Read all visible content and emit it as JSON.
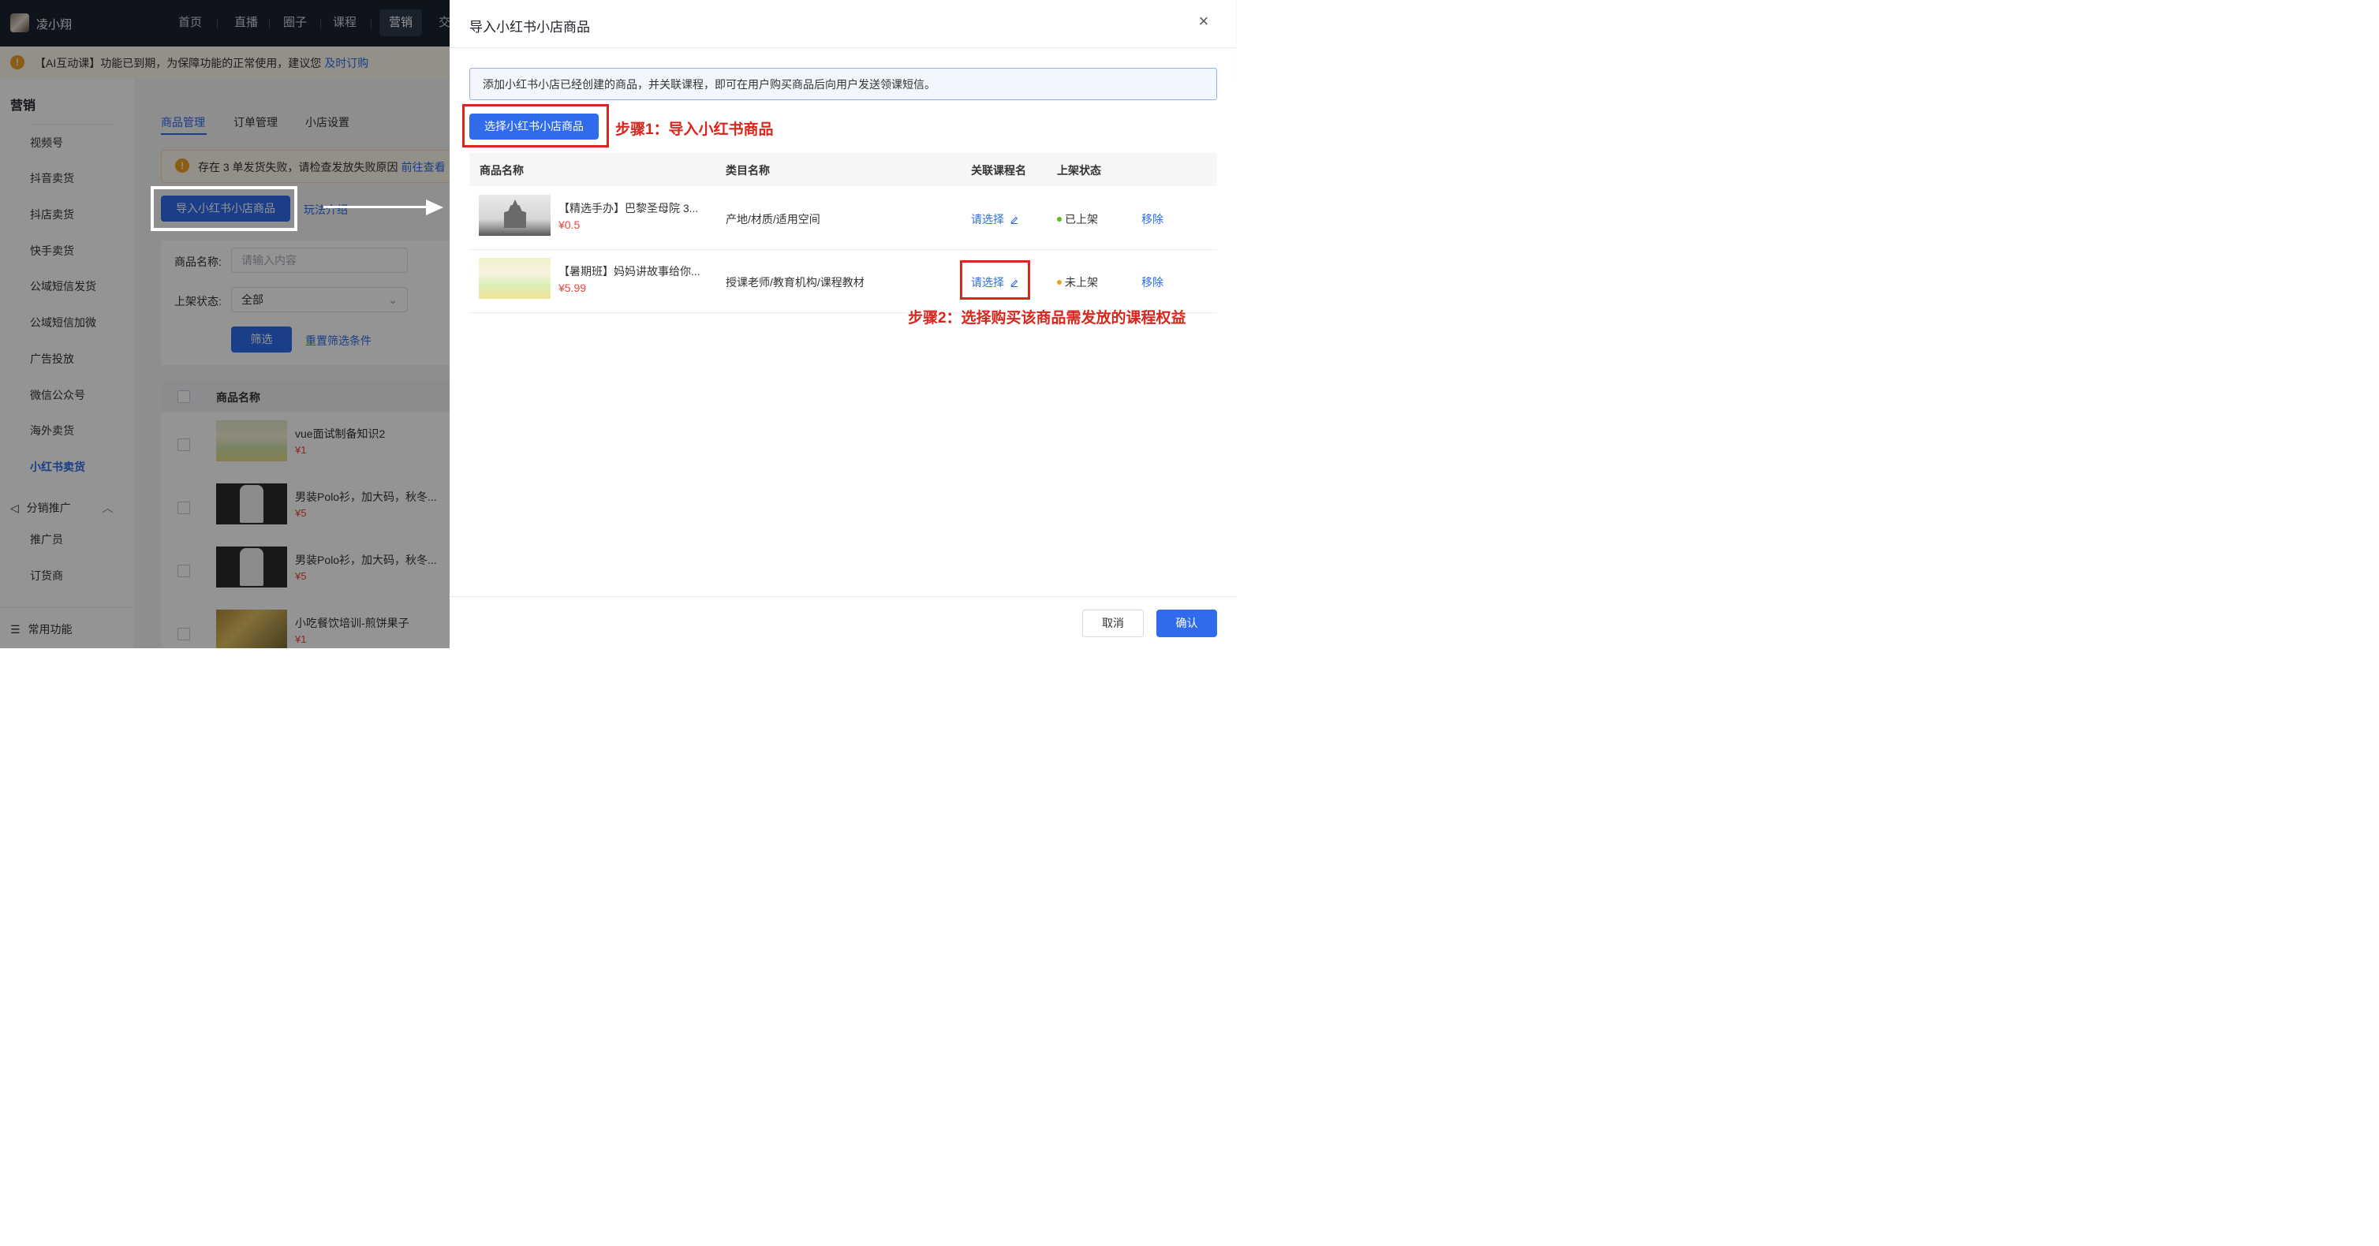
{
  "app": {
    "name": "凌小翔",
    "nav": [
      "首页",
      "直播",
      "圈子",
      "课程",
      "营销",
      "交"
    ],
    "warning": {
      "text": "【AI互动课】功能已到期，为保障功能的正常使用，建议您",
      "link": "及时订购"
    }
  },
  "sidebar": {
    "title": "营销",
    "items": [
      "视频号",
      "抖音卖货",
      "抖店卖货",
      "快手卖货",
      "公域短信发货",
      "公域短信加微",
      "广告投放",
      "微信公众号",
      "海外卖货",
      "小红书卖货"
    ],
    "group": "分销推广",
    "group_items": [
      "推广员",
      "订货商"
    ],
    "bottom": "常用功能"
  },
  "main": {
    "tabs": [
      "商品管理",
      "订单管理",
      "小店设置"
    ],
    "alert": {
      "text": "存在 3 单发货失败，请检查发放失败原因",
      "link": "前往查看"
    },
    "import_button": "导入小红书小店商品",
    "play_link": "玩法介绍",
    "filter": {
      "name_label": "商品名称:",
      "name_placeholder": "请输入内容",
      "status_label": "上架状态:",
      "status_value": "全部",
      "filter_button": "筛选",
      "reset_link": "重置筛选条件"
    },
    "table_header": "商品名称",
    "rows": [
      {
        "name": "vue面试制备知识2",
        "price": "¥1"
      },
      {
        "name": "男装Polo衫，加大码，秋冬...",
        "price": "¥5"
      },
      {
        "name": "男装Polo衫，加大码，秋冬...",
        "price": "¥5"
      },
      {
        "name": "小吃餐饮培训-煎饼果子",
        "price": "¥1"
      }
    ]
  },
  "drawer": {
    "title": "导入小红书小店商品",
    "close_icon": "close-icon",
    "info": "添加小红书小店已经创建的商品，并关联课程，即可在用户购买商品后向用户发送领课短信。",
    "select_button": "选择小红书小店商品",
    "step1": "步骤1：导入小红书商品",
    "step2": "步骤2：选择购买该商品需发放的课程权益",
    "columns": [
      "商品名称",
      "类目名称",
      "关联课程名",
      "上架状态"
    ],
    "rows": [
      {
        "name": "【精选手办】巴黎圣母院 3...",
        "price": "¥0.5",
        "category": "产地/材质/适用空间",
        "link": "请选择",
        "status": "已上架",
        "status_color": "#52c41a",
        "action": "移除"
      },
      {
        "name": "【暑期班】妈妈讲故事给你...",
        "price": "¥5.99",
        "category": "授课老师/教育机构/课程教材",
        "link": "请选择",
        "status": "未上架",
        "status_color": "#f0a020",
        "action": "移除"
      }
    ],
    "cancel": "取消",
    "confirm": "确认"
  }
}
